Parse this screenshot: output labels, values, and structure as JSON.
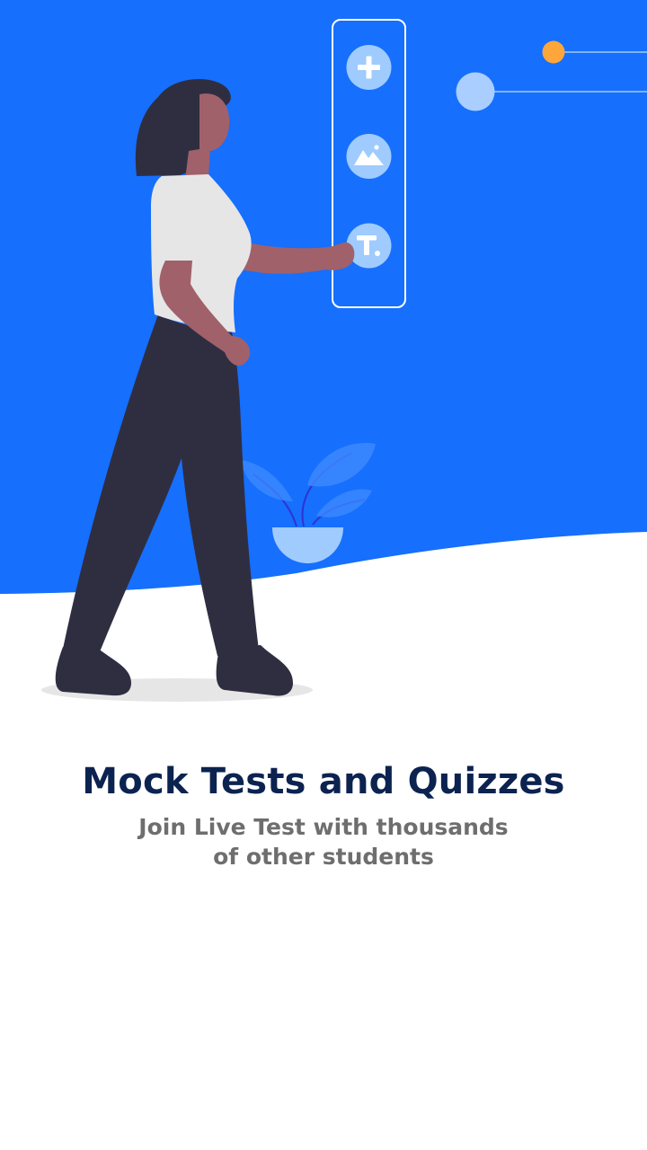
{
  "onboarding": {
    "title": "Mock Tests and Quizzes",
    "subtitle": "Join Live Test with thousands of other students"
  },
  "illustration": {
    "toolbar_icons": [
      "plus-icon",
      "image-icon",
      "text-icon"
    ],
    "scene": [
      "woman-figure",
      "potted-plant",
      "decorative-dots"
    ]
  },
  "colors": {
    "background_blue": "#166FFD",
    "light_blue": "#9FCBFF",
    "accent_orange": "#FFA63A",
    "title_navy": "#0C2350",
    "subtitle_gray": "#6E6E6E",
    "figure_dark": "#2F2E41",
    "skin": "#A0616A",
    "shirt": "#E6E6E6"
  }
}
